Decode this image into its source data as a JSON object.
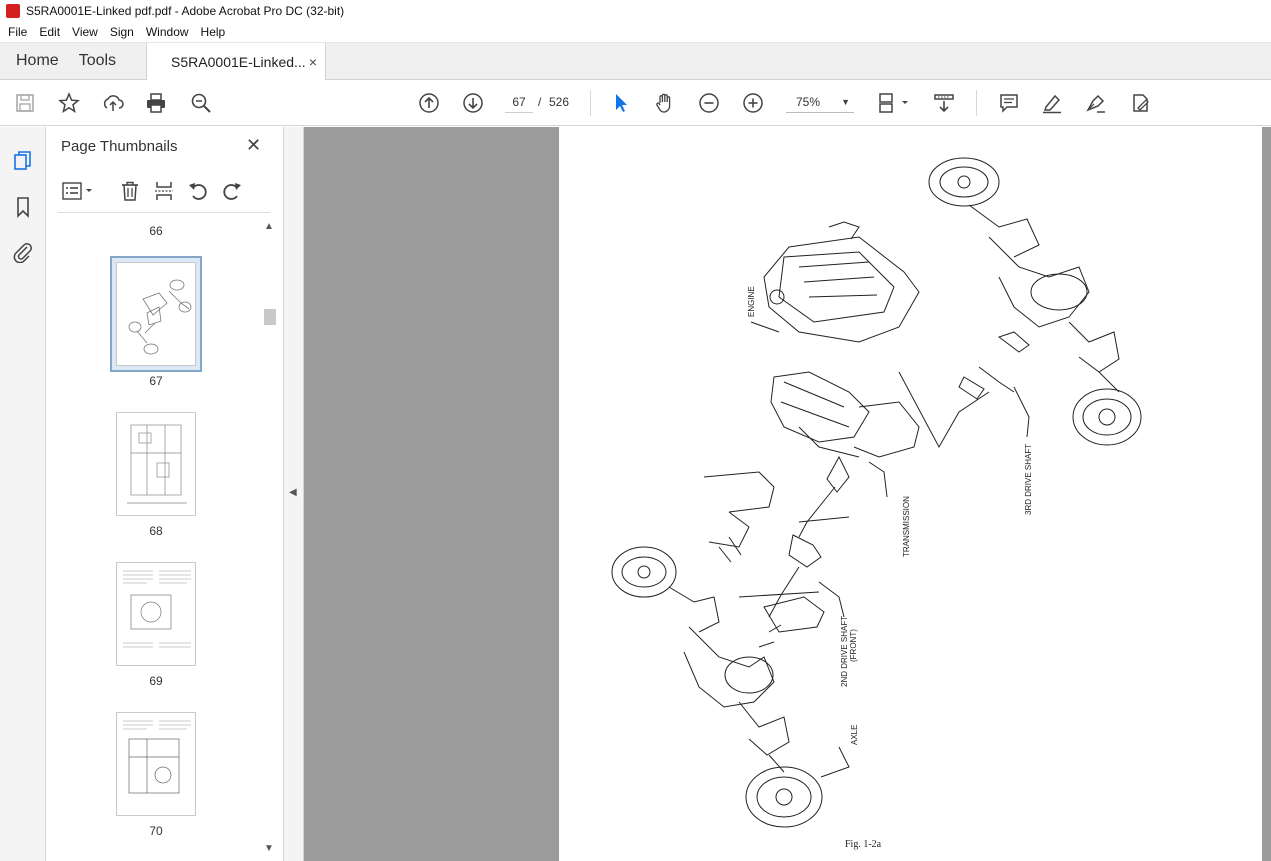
{
  "window": {
    "title": "S5RA0001E-Linked pdf.pdf - Adobe Acrobat Pro DC (32-bit)"
  },
  "menu": [
    "File",
    "Edit",
    "View",
    "Sign",
    "Window",
    "Help"
  ],
  "tabs": {
    "home": "Home",
    "tools": "Tools",
    "document": "S5RA0001E-Linked...",
    "close": "×"
  },
  "toolbar": {
    "current_page": "67",
    "page_separator": "/",
    "total_pages": "526",
    "zoom": "75%",
    "icons": [
      "save-icon",
      "star-icon",
      "upload-icon",
      "print-icon",
      "zoom-search-icon",
      "page-up-icon",
      "page-down-icon",
      "select-cursor-icon",
      "hand-icon",
      "zoom-out-icon",
      "zoom-in-icon",
      "fit-page-icon",
      "scroll-mode-icon",
      "comment-icon",
      "highlight-icon",
      "sign-icon",
      "fill-sign-icon"
    ]
  },
  "thumbnails_panel": {
    "title": "Page Thumbnails",
    "close": "✕",
    "pages": [
      "66",
      "67",
      "68",
      "69",
      "70"
    ],
    "selected": "67"
  },
  "document": {
    "labels": {
      "engine": "ENGINE",
      "transmission": "TRANSMISSION",
      "third_drive_shaft": "3RD DRIVE SHAFT",
      "second_drive_shaft": "2ND DRIVE SHAFT",
      "front": "(FRONT)",
      "axle": "AXLE",
      "figure": "Fig. 1-2a"
    }
  },
  "colors": {
    "accent_blue": "#1473e6",
    "select_border": "#86a6c8",
    "doc_background": "#9b9b9b"
  }
}
